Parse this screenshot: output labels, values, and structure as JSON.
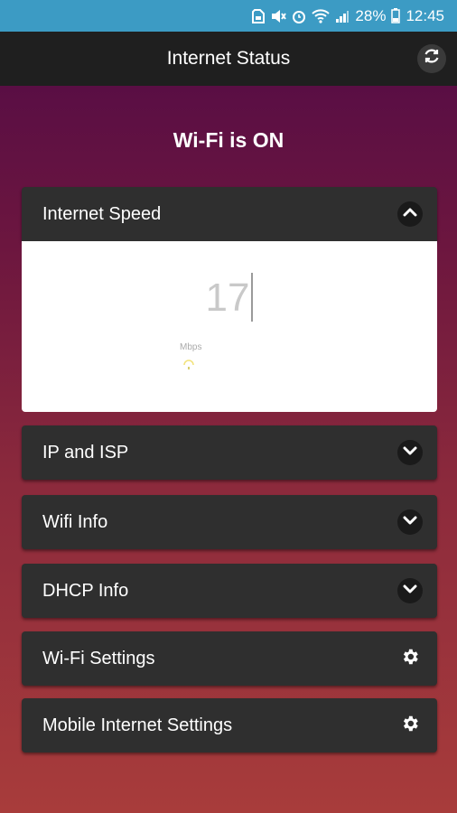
{
  "status_bar": {
    "battery": "28%",
    "time": "12:45"
  },
  "app_bar": {
    "title": "Internet Status"
  },
  "wifi_status": "Wi-Fi is ON",
  "speed_panel": {
    "title": "Internet Speed",
    "value": "17",
    "unit": "Mbps"
  },
  "sections": [
    {
      "label": "IP and ISP",
      "icon": "chevron-down-icon"
    },
    {
      "label": "Wifi Info",
      "icon": "chevron-down-icon"
    },
    {
      "label": "DHCP Info",
      "icon": "chevron-down-icon"
    },
    {
      "label": "Wi-Fi Settings",
      "icon": "gear-icon"
    },
    {
      "label": "Mobile Internet Settings",
      "icon": "gear-icon"
    }
  ]
}
